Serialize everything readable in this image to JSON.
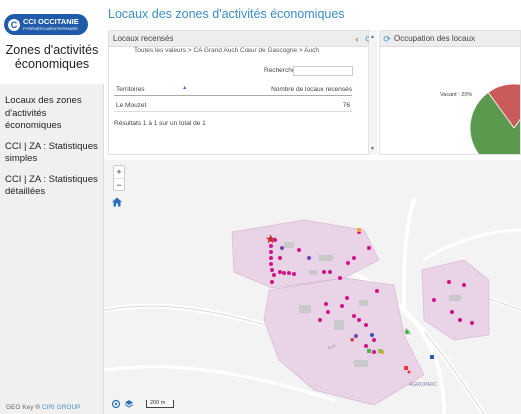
{
  "brand": {
    "line1": "CCI OCCITANIE",
    "line2": "PYRÉNÉES-MÉDITERRANÉE",
    "color": "#1f5ba8"
  },
  "sidebar": {
    "app_title": "Zones d'activités économiques",
    "items": [
      {
        "label": "Locaux des zones d'activités économiques"
      },
      {
        "label": "CCI | ZA : Statistiques simples"
      },
      {
        "label": "CCI | ZA : Statistiques détaillées"
      }
    ],
    "footer_prefix": "GEO Key ® ",
    "footer_link": "CIRI GROUP"
  },
  "page": {
    "title": "Locaux des zones d'activités économiques",
    "accent": "#3a8ec9"
  },
  "locaux_panel": {
    "title": "Locaux recensés",
    "breadcrumb": "Toutes les valeurs > CA Grand Auch Cœur de Gascogne > Auch",
    "search_label": "Recherche :",
    "search_value": "",
    "columns": [
      "Territoires",
      "Nombre de locaux recensés"
    ],
    "rows": [
      {
        "territoire": "Le Mouzet",
        "nombre": "76"
      }
    ],
    "info": "Résultats 1 à 1 sur un total de 1"
  },
  "occupation_panel": {
    "title": "Occupation des locaux",
    "pie_label": "Vacant : 20%",
    "chart_data": {
      "type": "pie",
      "slices": [
        {
          "label": "Vacant",
          "value": 20,
          "color": "#c95b5b"
        },
        {
          "label": "",
          "value": 80,
          "color": "#5b9a4e"
        }
      ]
    }
  },
  "map": {
    "scale_label": "200 m",
    "zone_label": "AGROPARC",
    "zone_color": "#e8d4e6"
  }
}
